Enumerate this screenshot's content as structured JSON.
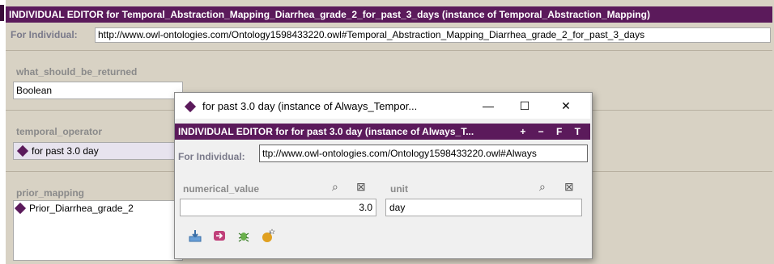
{
  "main": {
    "title": "INDIVIDUAL EDITOR for Temporal_Abstraction_Mapping_Diarrhea_grade_2_for_past_3_days  (instance of Temporal_Abstraction_Mapping)",
    "for_individual_label": "For Individual:",
    "for_individual_value": "http://www.owl-ontologies.com/Ontology1598433220.owl#Temporal_Abstraction_Mapping_Diarrhea_grade_2_for_past_3_days",
    "what_should_be_returned": {
      "label": "what_should_be_returned",
      "value": "Boolean"
    },
    "temporal_operator": {
      "label": "temporal_operator",
      "value": "for past 3.0 day"
    },
    "prior_mapping": {
      "label": "prior_mapping",
      "items": [
        "Prior_Diarrhea_grade_2"
      ]
    }
  },
  "dialog": {
    "window_title": "for past 3.0 day  (instance of Always_Tempor...",
    "minimize": "—",
    "maximize": "☐",
    "close": "✕",
    "header": "INDIVIDUAL EDITOR for for past 3.0 day  (instance of Always_T...",
    "header_buttons": "+ − F T",
    "for_individual_label": "For Individual:",
    "for_individual_value": "ttp://www.owl-ontologies.com/Ontology1598433220.owl#Always",
    "numerical_value": {
      "label": "numerical_value",
      "value": "3.0"
    },
    "unit": {
      "label": "unit",
      "value": "day"
    },
    "toolbar": [
      {
        "icon": "import-icon"
      },
      {
        "icon": "arrow-right-icon"
      },
      {
        "icon": "bug-icon"
      },
      {
        "icon": "bomb-icon"
      }
    ]
  },
  "colors": {
    "header": "#5b1a5b",
    "background": "#d8d2c4"
  }
}
